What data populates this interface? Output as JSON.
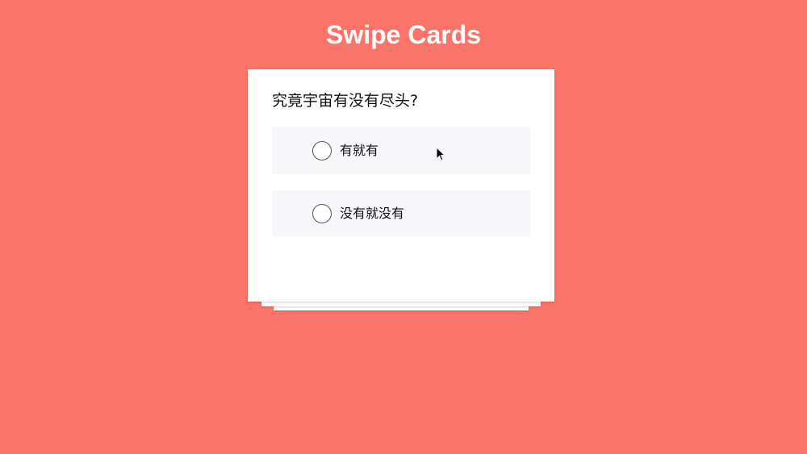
{
  "header": {
    "title": "Swipe Cards"
  },
  "card": {
    "question": "究竟宇宙有没有尽头?",
    "options": [
      {
        "label": "有就有",
        "selected": false
      },
      {
        "label": "没有就没有",
        "selected": false
      }
    ]
  },
  "colors": {
    "background": "#fb7469",
    "card": "#ffffff",
    "option_background": "#f7f6f8"
  },
  "icons": {
    "cursor": "mouse-pointer-icon",
    "radio": "radio-circle-icon"
  }
}
